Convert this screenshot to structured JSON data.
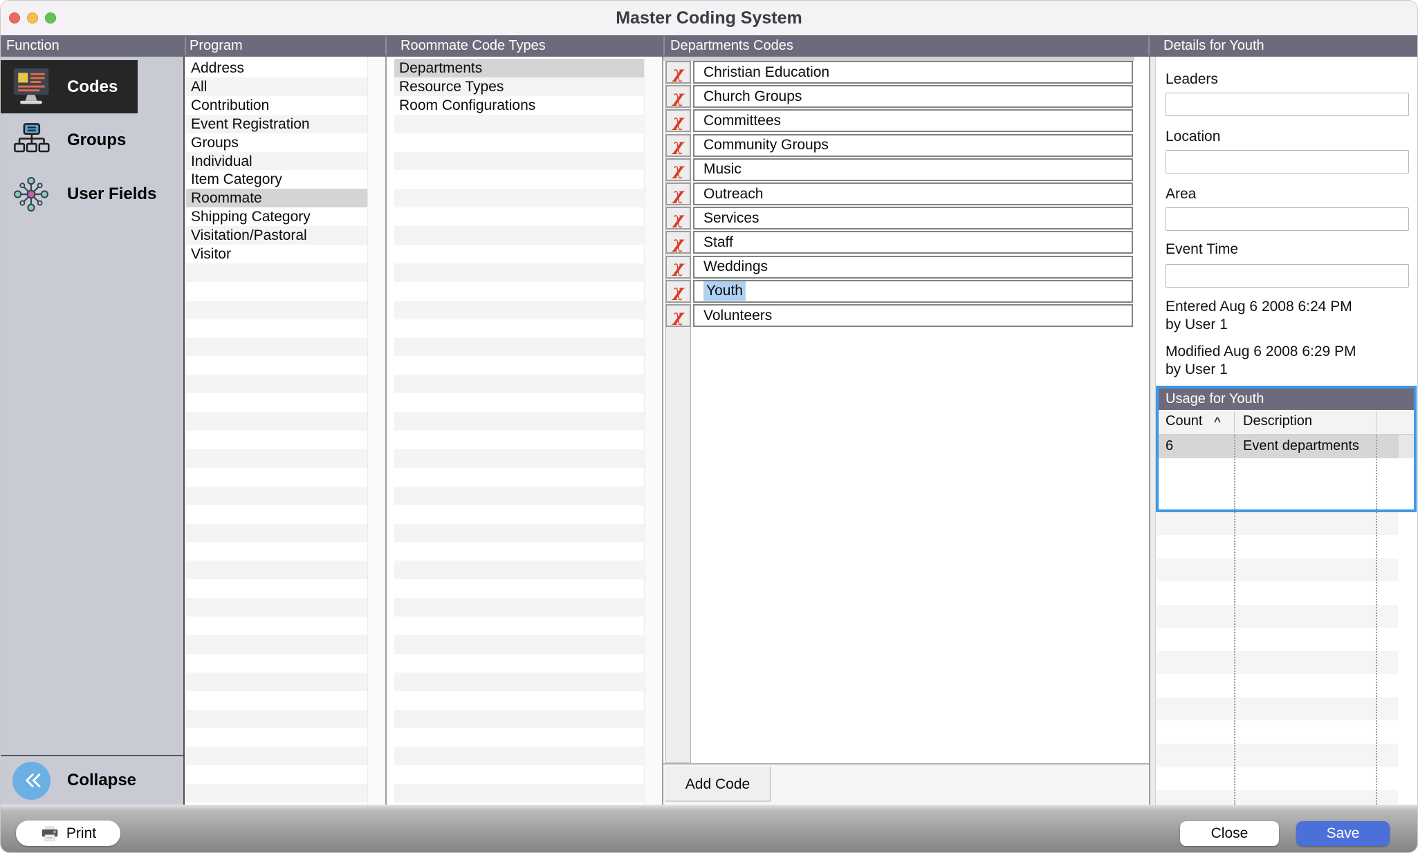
{
  "window": {
    "title": "Master Coding System"
  },
  "header": {
    "columns": [
      "Function",
      "Program",
      "Roommate Code Types",
      "Departments Codes",
      "Details for Youth"
    ]
  },
  "sidebar": {
    "items": [
      {
        "label": "Codes",
        "icon": "codes-monitor-icon",
        "selected": true
      },
      {
        "label": "Groups",
        "icon": "groups-orgchart-icon",
        "selected": false
      },
      {
        "label": "User Fields",
        "icon": "user-fields-network-icon",
        "selected": false
      }
    ],
    "collapse_label": "Collapse",
    "collapse_icon": "double-chevron-left-icon"
  },
  "program": {
    "items": [
      "Address",
      "All",
      "Contribution",
      "Event Registration",
      "Groups",
      "Individual",
      "Item Category",
      "Roommate",
      "Shipping Category",
      "Visitation/Pastoral",
      "Visitor"
    ],
    "selected": "Roommate"
  },
  "roommate_code_types": {
    "items": [
      "Departments",
      "Resource Types",
      "Room Configurations"
    ],
    "selected": "Departments"
  },
  "departments_codes": {
    "items": [
      "Christian Education",
      "Church Groups",
      "Committees",
      "Community Groups",
      "Music",
      "Outreach",
      "Services",
      "Staff",
      "Weddings",
      "Youth",
      "Volunteers"
    ],
    "selected": "Youth",
    "delete_icon_glyph": "χ",
    "add_button": "Add Code"
  },
  "details": {
    "fields": [
      {
        "label": "Leaders",
        "value": "",
        "placeholder": ""
      },
      {
        "label": "Location",
        "value": "",
        "placeholder": ""
      },
      {
        "label": "Area",
        "value": "",
        "placeholder": ""
      },
      {
        "label": "Event Time",
        "value": "",
        "placeholder": ""
      }
    ],
    "entered_line1": "Entered Aug 6 2008 6:24 PM",
    "entered_line2": "by User 1",
    "modified_line1": "Modified Aug 6 2008 6:29 PM",
    "modified_line2": "by User 1"
  },
  "usage": {
    "title": "Usage for Youth",
    "columns": [
      "Count",
      "Description"
    ],
    "sort_indicator": "^",
    "rows": [
      {
        "count": "6",
        "description": "Event departments"
      }
    ]
  },
  "footer": {
    "print": "Print",
    "close": "Close",
    "save": "Save"
  },
  "colors": {
    "header_bar": "#6c6b7b",
    "sidebar_bg": "#c9cbd4",
    "selected_sidebar": "#262626",
    "selected_row": "#d4d4d4",
    "delete_icon": "#dc3b27",
    "text_selection": "#b0d2f2",
    "focus_border": "#3e99e8",
    "save_button": "#4b70d9",
    "collapse_circle": "#6cb0e3"
  }
}
